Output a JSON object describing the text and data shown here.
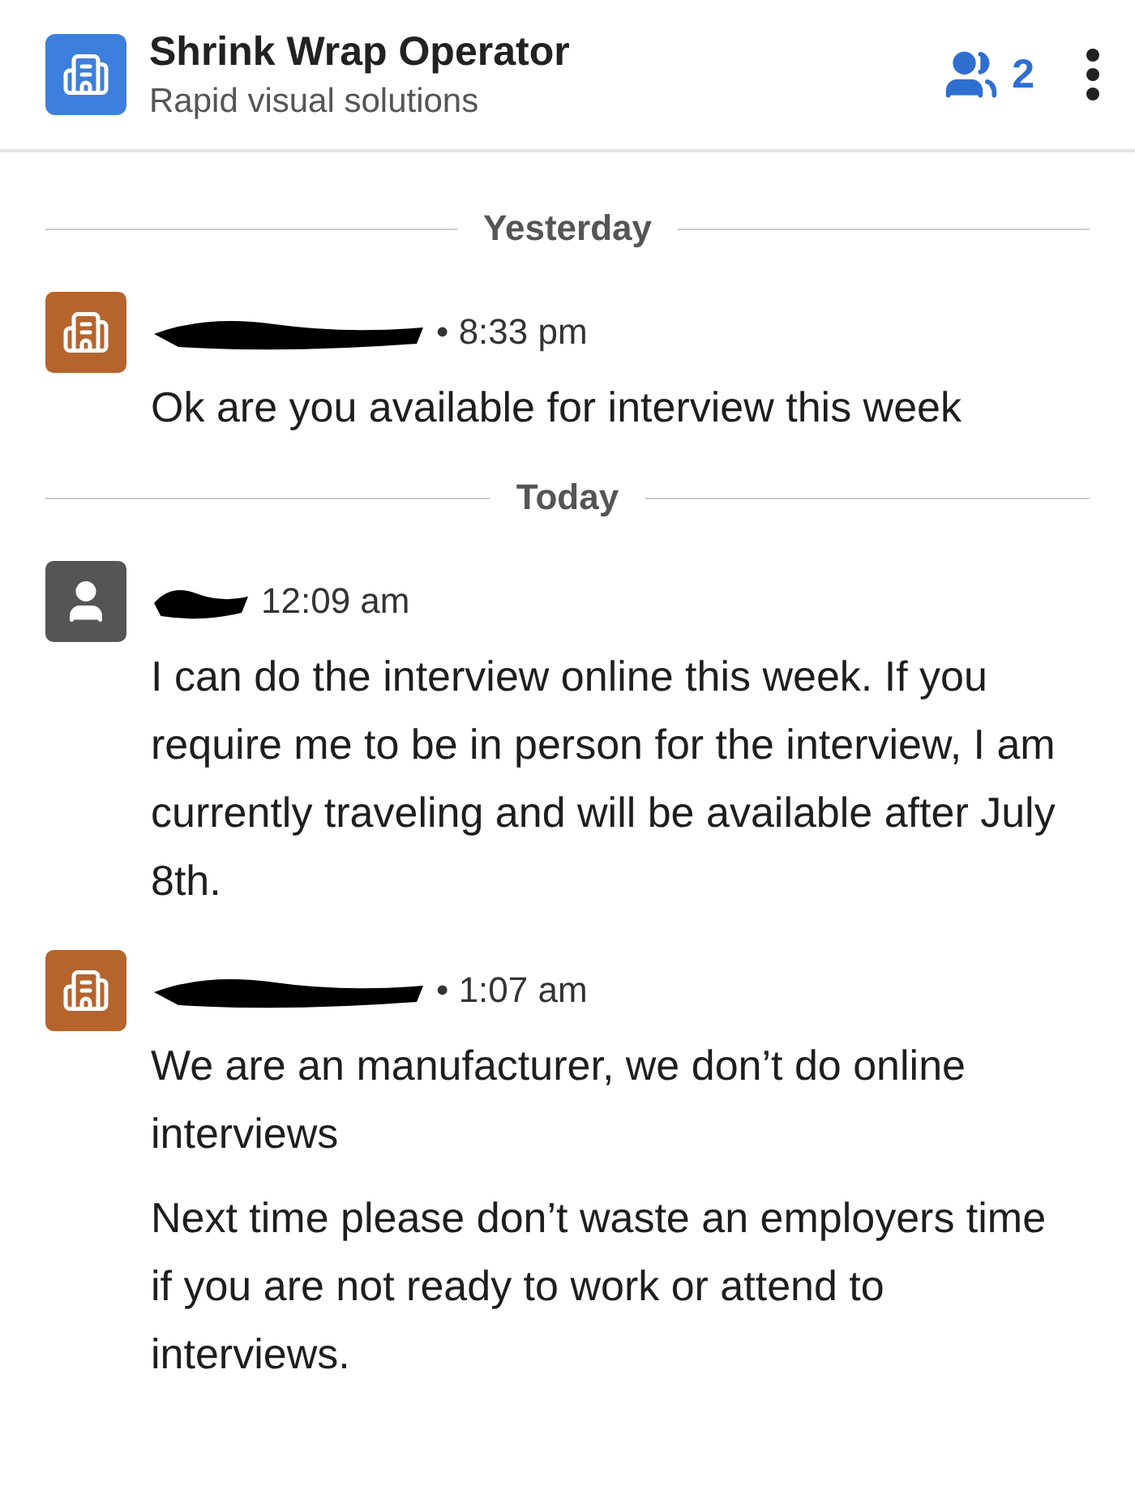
{
  "header": {
    "title": "Shrink Wrap Operator",
    "subtitle": "Rapid visual solutions",
    "member_count": "2"
  },
  "feed": [
    {
      "kind": "divider",
      "label": "Yesterday"
    },
    {
      "kind": "message",
      "avatar": {
        "kind": "company"
      },
      "time": "• 8:33 pm",
      "paragraphs": [
        "Ok are you available for interview this week"
      ]
    },
    {
      "kind": "divider",
      "label": "Today"
    },
    {
      "kind": "message",
      "avatar": {
        "kind": "person"
      },
      "time": "12:09 am",
      "paragraphs": [
        "I can do the interview online this week. If you require me to be in person for the interview, I am currently traveling and will be available after July 8th."
      ]
    },
    {
      "kind": "message",
      "avatar": {
        "kind": "company"
      },
      "time": "• 1:07 am",
      "paragraphs": [
        "We are an manufacturer, we don’t do online interviews",
        "Next time please don’t waste an employers time if you are not ready to work or attend to interviews."
      ]
    }
  ]
}
